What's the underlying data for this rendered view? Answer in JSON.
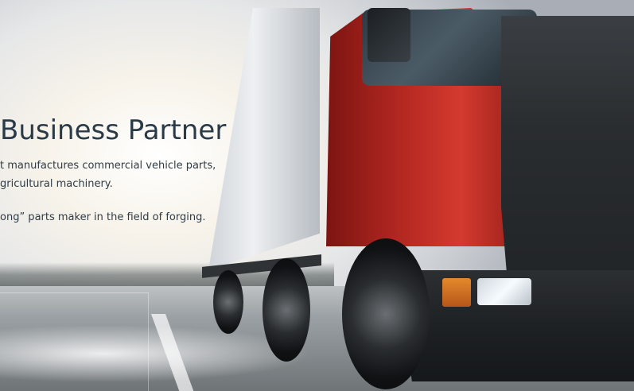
{
  "hero": {
    "title": "Business Partner",
    "description_lines": [
      "t manufactures commercial vehicle parts,",
      "gricultural machinery.",
      "ong” parts maker in the field of forging."
    ]
  },
  "colors": {
    "title_text": "#2b3a47",
    "body_text": "#2f3b45",
    "truck_cab_red": "#b22721"
  },
  "icons": {
    "background_image": "semi-truck-photo"
  }
}
